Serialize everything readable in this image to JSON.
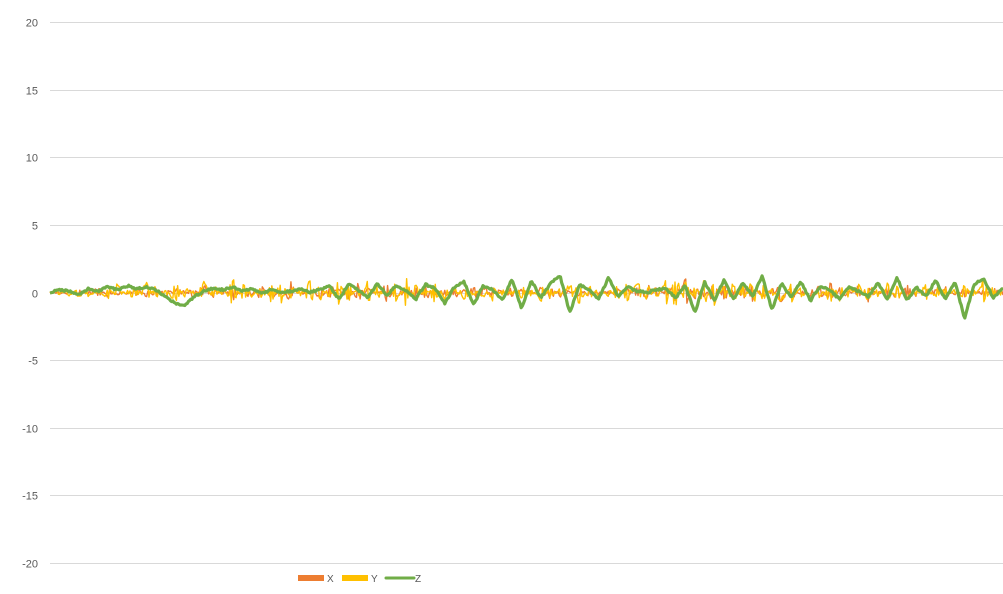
{
  "chart_data": {
    "type": "line",
    "title": "",
    "xlabel": "",
    "ylabel": "",
    "ylim": [
      -20,
      20
    ],
    "yticks": [
      20,
      15,
      10,
      5,
      0,
      -5,
      -10,
      -15,
      -20
    ],
    "grid": true,
    "legend": "bottom",
    "x_count": 800,
    "series": [
      {
        "name": "X",
        "color": "#ED7D31",
        "values": [
          0.05,
          -0.1,
          0.15,
          -0.2,
          0.1,
          0.25,
          -0.3,
          0.2,
          -0.15,
          0.3,
          -0.25,
          0.35,
          -0.4,
          0.2,
          0.1,
          -0.35,
          0.5,
          -0.3,
          0.2,
          -0.45,
          0.3,
          0.15,
          -0.5,
          0.4,
          -0.2,
          0.6,
          -0.3,
          0.1,
          -0.55,
          0.35,
          0.2,
          -0.4,
          0.55,
          -0.25,
          0.15,
          -0.6,
          0.45,
          -0.1,
          0.3,
          -0.5,
          0.25,
          -0.35,
          0.4,
          -0.2,
          0.5,
          -0.45,
          0.3,
          0.1,
          -0.3,
          0.2,
          -0.15,
          0.35,
          -0.4,
          0.25,
          0.05,
          -0.2,
          0.3,
          -0.1,
          0.15,
          -0.35,
          0.4,
          -0.5,
          0.55,
          -0.3,
          0.2,
          -0.6,
          0.8,
          -0.4,
          0.3,
          -0.7,
          0.5,
          -0.2,
          0.6,
          -0.55,
          0.4,
          -0.3,
          0.7,
          -0.45,
          0.25,
          -0.35,
          0.5,
          -0.6,
          0.3,
          0.1,
          -0.4,
          0.6,
          -0.2,
          0.35,
          -0.5,
          0.45,
          -0.25,
          0.2,
          -0.3,
          0.4,
          -0.15,
          0.25,
          -0.1,
          0.2,
          -0.3,
          0.15
        ],
        "y_range": [
          -1.0,
          1.0
        ]
      },
      {
        "name": "Y",
        "color": "#FFC000",
        "values": [
          0.1,
          -0.2,
          0.3,
          -0.35,
          0.25,
          -0.1,
          0.4,
          -0.5,
          0.2,
          0.35,
          -0.6,
          0.45,
          -0.3,
          0.7,
          -0.4,
          0.2,
          -0.65,
          0.5,
          -0.25,
          0.8,
          -0.55,
          0.3,
          -0.45,
          0.6,
          -0.7,
          0.4,
          -0.2,
          0.75,
          -0.5,
          0.35,
          -0.8,
          0.55,
          -0.3,
          0.65,
          -0.4,
          0.25,
          -0.7,
          0.9,
          -0.5,
          0.3,
          -0.6,
          0.45,
          -0.35,
          0.55,
          -0.25,
          0.4,
          -0.5,
          0.3,
          -0.2,
          0.45,
          -0.35,
          0.6,
          -0.4,
          0.25,
          -0.55,
          0.7,
          -0.45,
          0.35,
          -0.3,
          0.5,
          -0.65,
          0.8,
          -0.5,
          0.4,
          -0.75,
          0.95,
          -0.6,
          0.45,
          -0.8,
          0.7,
          -0.4,
          0.6,
          -0.55,
          0.85,
          -0.5,
          0.3,
          -0.7,
          0.6,
          -0.45,
          0.5,
          -0.35,
          0.65,
          -0.6,
          0.4,
          -0.5,
          0.75,
          -0.3,
          0.55,
          -0.45,
          0.35,
          -0.25,
          0.5,
          -0.4,
          0.3,
          -0.2,
          0.45,
          -0.35,
          1.0,
          -0.5,
          0.4
        ],
        "y_range": [
          -1.1,
          1.1
        ]
      },
      {
        "name": "Z",
        "color": "#70AD47",
        "values": [
          0.0,
          0.2,
          0.1,
          -0.2,
          0.3,
          0.1,
          0.4,
          0.2,
          0.5,
          0.3,
          0.4,
          0.2,
          -0.3,
          -0.8,
          -1.0,
          -0.3,
          0.1,
          0.3,
          0.2,
          0.4,
          0.1,
          0.3,
          -0.1,
          0.2,
          0.0,
          0.1,
          0.3,
          0.0,
          0.2,
          0.5,
          -0.5,
          0.6,
          0.2,
          -0.4,
          0.7,
          -0.2,
          0.5,
          0.1,
          -0.5,
          0.6,
          0.3,
          -0.8,
          0.4,
          0.8,
          -0.9,
          0.5,
          0.2,
          -0.6,
          1.0,
          -1.2,
          0.9,
          -0.4,
          0.7,
          1.2,
          -1.5,
          0.6,
          0.2,
          -0.5,
          1.1,
          -0.3,
          0.4,
          0.1,
          0.0,
          0.2,
          0.3,
          -0.4,
          0.5,
          -1.5,
          0.8,
          -0.6,
          0.9,
          -0.5,
          0.7,
          -0.3,
          1.2,
          -1.3,
          0.7,
          -0.4,
          0.8,
          -0.6,
          0.5,
          0.2,
          -0.5,
          0.4,
          0.1,
          -0.3,
          0.7,
          -0.5,
          1.1,
          -0.6,
          0.4,
          -0.3,
          0.9,
          -0.5,
          0.8,
          -1.9,
          0.6,
          1.0,
          -0.4,
          0.3
        ],
        "y_range": [
          -2.0,
          1.3
        ]
      }
    ]
  }
}
